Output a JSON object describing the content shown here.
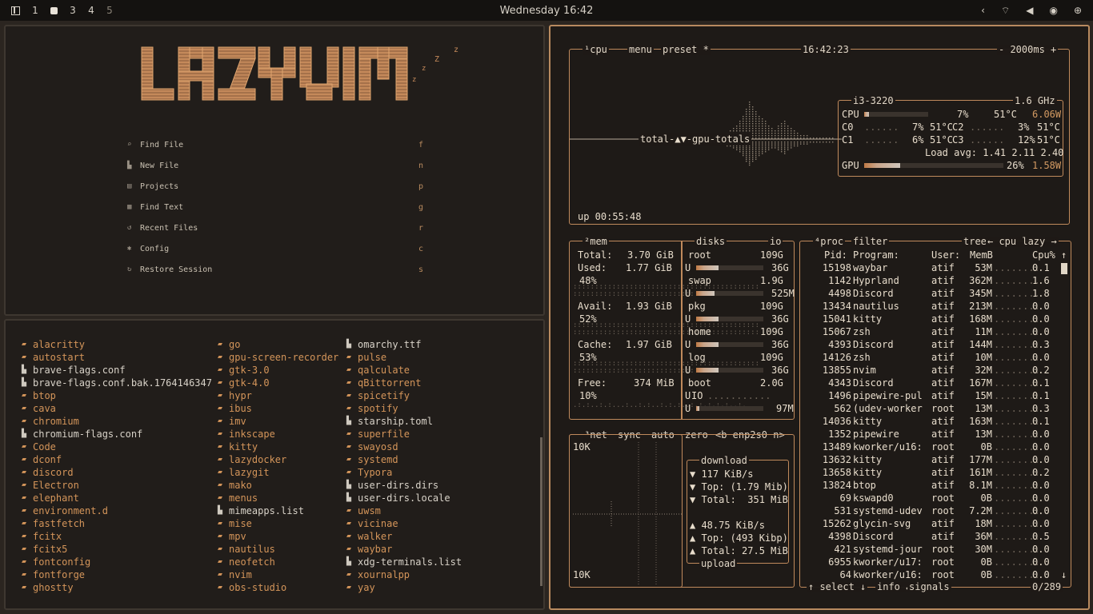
{
  "topbar": {
    "workspaces": [
      "1",
      "3",
      "4",
      "5"
    ],
    "clock": "Wednesday 16:42"
  },
  "lazyvim": {
    "logo_text": "LAZYVIM",
    "zzz": [
      "z",
      "z",
      "Z",
      "z"
    ],
    "menu": [
      {
        "icon": "search-icon",
        "label": "Find File",
        "key": "f"
      },
      {
        "icon": "file-icon",
        "label": "New File",
        "key": "n"
      },
      {
        "icon": "folder-icon",
        "label": "Projects",
        "key": "p"
      },
      {
        "icon": "text-icon",
        "label": "Find Text",
        "key": "g"
      },
      {
        "icon": "history-icon",
        "label": "Recent Files",
        "key": "r"
      },
      {
        "icon": "gear-icon",
        "label": "Config",
        "key": "c"
      },
      {
        "icon": "restore-icon",
        "label": "Restore Session",
        "key": "s"
      }
    ]
  },
  "files": {
    "col1": [
      {
        "n": "alacritty",
        "t": "dir"
      },
      {
        "n": "autostart",
        "t": "dir"
      },
      {
        "n": "brave-flags.conf",
        "t": "file"
      },
      {
        "n": "brave-flags.conf.bak.1764146347",
        "t": "file"
      },
      {
        "n": "btop",
        "t": "dir"
      },
      {
        "n": "cava",
        "t": "dir"
      },
      {
        "n": "chromium",
        "t": "dir"
      },
      {
        "n": "chromium-flags.conf",
        "t": "file"
      },
      {
        "n": "Code",
        "t": "dir"
      },
      {
        "n": "dconf",
        "t": "dir"
      },
      {
        "n": "discord",
        "t": "dir"
      },
      {
        "n": "Electron",
        "t": "dir"
      },
      {
        "n": "elephant",
        "t": "dir"
      },
      {
        "n": "environment.d",
        "t": "dir"
      },
      {
        "n": "fastfetch",
        "t": "dir"
      },
      {
        "n": "fcitx",
        "t": "dir"
      },
      {
        "n": "fcitx5",
        "t": "dir"
      },
      {
        "n": "fontconfig",
        "t": "dir"
      },
      {
        "n": "fontforge",
        "t": "dir"
      },
      {
        "n": "ghostty",
        "t": "dir"
      }
    ],
    "col2": [
      {
        "n": "go",
        "t": "dir"
      },
      {
        "n": "gpu-screen-recorder",
        "t": "dir"
      },
      {
        "n": "gtk-3.0",
        "t": "dir"
      },
      {
        "n": "gtk-4.0",
        "t": "dir"
      },
      {
        "n": "hypr",
        "t": "dir"
      },
      {
        "n": "ibus",
        "t": "dir"
      },
      {
        "n": "imv",
        "t": "dir"
      },
      {
        "n": "inkscape",
        "t": "dir"
      },
      {
        "n": "kitty",
        "t": "dir"
      },
      {
        "n": "lazydocker",
        "t": "dir"
      },
      {
        "n": "lazygit",
        "t": "dir"
      },
      {
        "n": "mako",
        "t": "dir"
      },
      {
        "n": "menus",
        "t": "dir"
      },
      {
        "n": "mimeapps.list",
        "t": "file"
      },
      {
        "n": "mise",
        "t": "dir"
      },
      {
        "n": "mpv",
        "t": "dir"
      },
      {
        "n": "nautilus",
        "t": "dir"
      },
      {
        "n": "neofetch",
        "t": "dir"
      },
      {
        "n": "nvim",
        "t": "dir"
      },
      {
        "n": "obs-studio",
        "t": "dir"
      }
    ],
    "col3": [
      {
        "n": "omarchy.ttf",
        "t": "file"
      },
      {
        "n": "pulse",
        "t": "dir"
      },
      {
        "n": "qalculate",
        "t": "dir"
      },
      {
        "n": "qBittorrent",
        "t": "dir"
      },
      {
        "n": "spicetify",
        "t": "dir"
      },
      {
        "n": "spotify",
        "t": "dir"
      },
      {
        "n": "starship.toml",
        "t": "file"
      },
      {
        "n": "superfile",
        "t": "dir"
      },
      {
        "n": "swayosd",
        "t": "dir"
      },
      {
        "n": "systemd",
        "t": "dir"
      },
      {
        "n": "Typora",
        "t": "dir"
      },
      {
        "n": "user-dirs.dirs",
        "t": "file"
      },
      {
        "n": "user-dirs.locale",
        "t": "file"
      },
      {
        "n": "uwsm",
        "t": "dir"
      },
      {
        "n": "vicinae",
        "t": "dir"
      },
      {
        "n": "walker",
        "t": "dir"
      },
      {
        "n": "waybar",
        "t": "dir"
      },
      {
        "n": "xdg-terminals.list",
        "t": "file"
      },
      {
        "n": "xournalpp",
        "t": "dir"
      },
      {
        "n": "yay",
        "t": "dir"
      }
    ]
  },
  "btop": {
    "cpu": {
      "labels": [
        "¹cpu",
        "menu",
        "preset *"
      ],
      "time": "16:42:23",
      "interval": "- 2000ms +",
      "graph_label": "total-▲▼-gpu-totals",
      "uptime": "up 00:55:48",
      "model": "i3-3220",
      "freq": "1.6 GHz",
      "cpu_line": {
        "name": "CPU",
        "pct": "7%",
        "temp": "51°C",
        "watts": "6.06W"
      },
      "cpu_fill": 0.07,
      "cores": [
        {
          "name": "C0",
          "pct": "7%",
          "temp": "51°C"
        },
        {
          "name": "C2",
          "pct": "3%",
          "temp": "51°C"
        },
        {
          "name": "C1",
          "pct": "6%",
          "temp": "51°C"
        },
        {
          "name": "C3",
          "pct": "12%",
          "temp": "51°C"
        }
      ],
      "load_avg": "Load avg: 1.41 2.11 2.40",
      "gpu_line": {
        "name": "GPU",
        "pct": "26%",
        "watts": "1.58W"
      },
      "gpu_fill": 0.26
    },
    "mem": {
      "labels": [
        "²mem",
        "disks",
        "io"
      ],
      "total": {
        "label": "Total:",
        "value": "3.70 GiB"
      },
      "used": {
        "label": "Used:",
        "value": "1.77 GiB",
        "pct": "48%"
      },
      "avail": {
        "label": "Avail:",
        "value": "1.93 GiB",
        "pct": "52%"
      },
      "cache": {
        "label": "Cache:",
        "value": "1.97 GiB",
        "pct": "53%"
      },
      "free": {
        "label": "Free:",
        "value": "374 MiB",
        "pct": "10%"
      }
    },
    "disks": [
      {
        "name": "root",
        "size": "109G",
        "used": "36G",
        "fill": 0.33
      },
      {
        "name": "swap",
        "size": "1.9G",
        "used": "525M",
        "fill": 0.27
      },
      {
        "name": "pkg",
        "size": "109G",
        "used": "36G",
        "fill": 0.33
      },
      {
        "name": "home",
        "size": "109G",
        "used": "36G",
        "fill": 0.33
      },
      {
        "name": "log",
        "size": "109G",
        "used": "36G",
        "fill": 0.33
      },
      {
        "name": "boot",
        "size": "2.0G",
        "used": "97M",
        "fill": 0.05,
        "io": "IO"
      }
    ],
    "disk_u": "U",
    "net": {
      "labels": [
        "³net",
        "sync",
        "auto",
        "zero",
        "<b enp2s0 n>"
      ],
      "scale_top": "10K",
      "scale_bottom": "10K",
      "download_title": "download",
      "dl_rate": "117 KiB/s",
      "dl_top": "Top: (1.79 Mib)",
      "dl_total": "Total:  351 MiB",
      "ul_rate": "48.75 KiB/s",
      "ul_top": "Top: (493 Kibp)",
      "ul_total": "Total: 27.5 MiB",
      "upload_title": "upload"
    },
    "proc": {
      "labels": [
        "⁴proc",
        "filter",
        "tree",
        "← cpu lazy →"
      ],
      "headers": {
        "pid": "Pid:",
        "program": "Program:",
        "user": "User:",
        "mem": "MemB",
        "cpu": "Cpu%"
      },
      "rows": [
        {
          "pid": "15198",
          "program": "waybar",
          "user": "atif",
          "mem": "53M",
          "cpu": "0.1"
        },
        {
          "pid": "1142",
          "program": "Hyprland",
          "user": "atif",
          "mem": "362M",
          "cpu": "1.6"
        },
        {
          "pid": "4498",
          "program": "Discord",
          "user": "atif",
          "mem": "345M",
          "cpu": "1.8"
        },
        {
          "pid": "13434",
          "program": "nautilus",
          "user": "atif",
          "mem": "213M",
          "cpu": "0.0"
        },
        {
          "pid": "15041",
          "program": "kitty",
          "user": "atif",
          "mem": "168M",
          "cpu": "0.0"
        },
        {
          "pid": "15067",
          "program": "zsh",
          "user": "atif",
          "mem": "11M",
          "cpu": "0.0"
        },
        {
          "pid": "4393",
          "program": "Discord",
          "user": "atif",
          "mem": "144M",
          "cpu": "0.3"
        },
        {
          "pid": "14126",
          "program": "zsh",
          "user": "atif",
          "mem": "10M",
          "cpu": "0.0"
        },
        {
          "pid": "13855",
          "program": "nvim",
          "user": "atif",
          "mem": "32M",
          "cpu": "0.2"
        },
        {
          "pid": "4343",
          "program": "Discord",
          "user": "atif",
          "mem": "167M",
          "cpu": "0.1"
        },
        {
          "pid": "1496",
          "program": "pipewire-pul",
          "user": "atif",
          "mem": "15M",
          "cpu": "0.1"
        },
        {
          "pid": "562",
          "program": "(udev-worker",
          "user": "root",
          "mem": "13M",
          "cpu": "0.3"
        },
        {
          "pid": "14036",
          "program": "kitty",
          "user": "atif",
          "mem": "163M",
          "cpu": "0.1"
        },
        {
          "pid": "1352",
          "program": "pipewire",
          "user": "atif",
          "mem": "13M",
          "cpu": "0.0"
        },
        {
          "pid": "13489",
          "program": "kworker/u16:",
          "user": "root",
          "mem": "0B",
          "cpu": "0.0"
        },
        {
          "pid": "13632",
          "program": "kitty",
          "user": "atif",
          "mem": "177M",
          "cpu": "0.0"
        },
        {
          "pid": "13658",
          "program": "kitty",
          "user": "atif",
          "mem": "161M",
          "cpu": "0.2"
        },
        {
          "pid": "13824",
          "program": "btop",
          "user": "atif",
          "mem": "8.1M",
          "cpu": "0.0"
        },
        {
          "pid": "69",
          "program": "kswapd0",
          "user": "root",
          "mem": "0B",
          "cpu": "0.0"
        },
        {
          "pid": "531",
          "program": "systemd-udev",
          "user": "root",
          "mem": "7.2M",
          "cpu": "0.0"
        },
        {
          "pid": "15262",
          "program": "glycin-svg",
          "user": "atif",
          "mem": "18M",
          "cpu": "0.0"
        },
        {
          "pid": "4398",
          "program": "Discord",
          "user": "atif",
          "mem": "36M",
          "cpu": "0.5"
        },
        {
          "pid": "421",
          "program": "systemd-jour",
          "user": "root",
          "mem": "30M",
          "cpu": "0.0"
        },
        {
          "pid": "6955",
          "program": "kworker/u17:",
          "user": "root",
          "mem": "0B",
          "cpu": "0.0"
        },
        {
          "pid": "64",
          "program": "kworker/u16:",
          "user": "root",
          "mem": "0B",
          "cpu": "0.0"
        }
      ],
      "footer_select": "↑ select ↓",
      "footer_info": "info ↵",
      "footer_signals": "signals",
      "footer_count": "0/289"
    }
  }
}
